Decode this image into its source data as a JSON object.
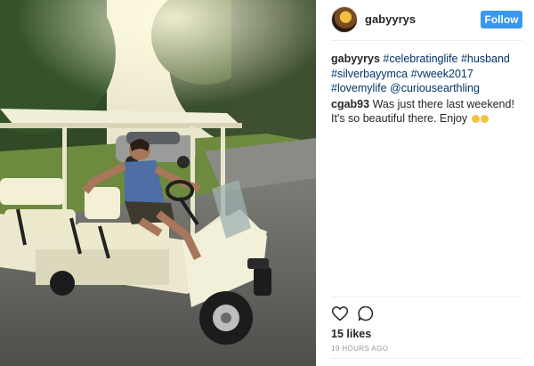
{
  "post": {
    "username": "gabyyrys",
    "follow_label": "Follow",
    "photo_alt": "photo"
  },
  "caption": {
    "user": "gabyyrys",
    "tags": [
      "#celebratinglife",
      "#husband",
      "#silverbayymca",
      "#vweek2017",
      "#lovemylife",
      "@curiousearthling"
    ]
  },
  "comment": {
    "user": "cgab93",
    "text": "Was just there last weekend! It's so beautiful there. Enjoy"
  },
  "actions": {
    "like_icon": "heart-icon",
    "comment_icon": "comment-icon"
  },
  "likes": "15 likes",
  "timestamp": "19 HOURS AGO",
  "colors": {
    "follow_bg": "#3897f0",
    "hashtag": "#003569",
    "muted": "#999999"
  }
}
